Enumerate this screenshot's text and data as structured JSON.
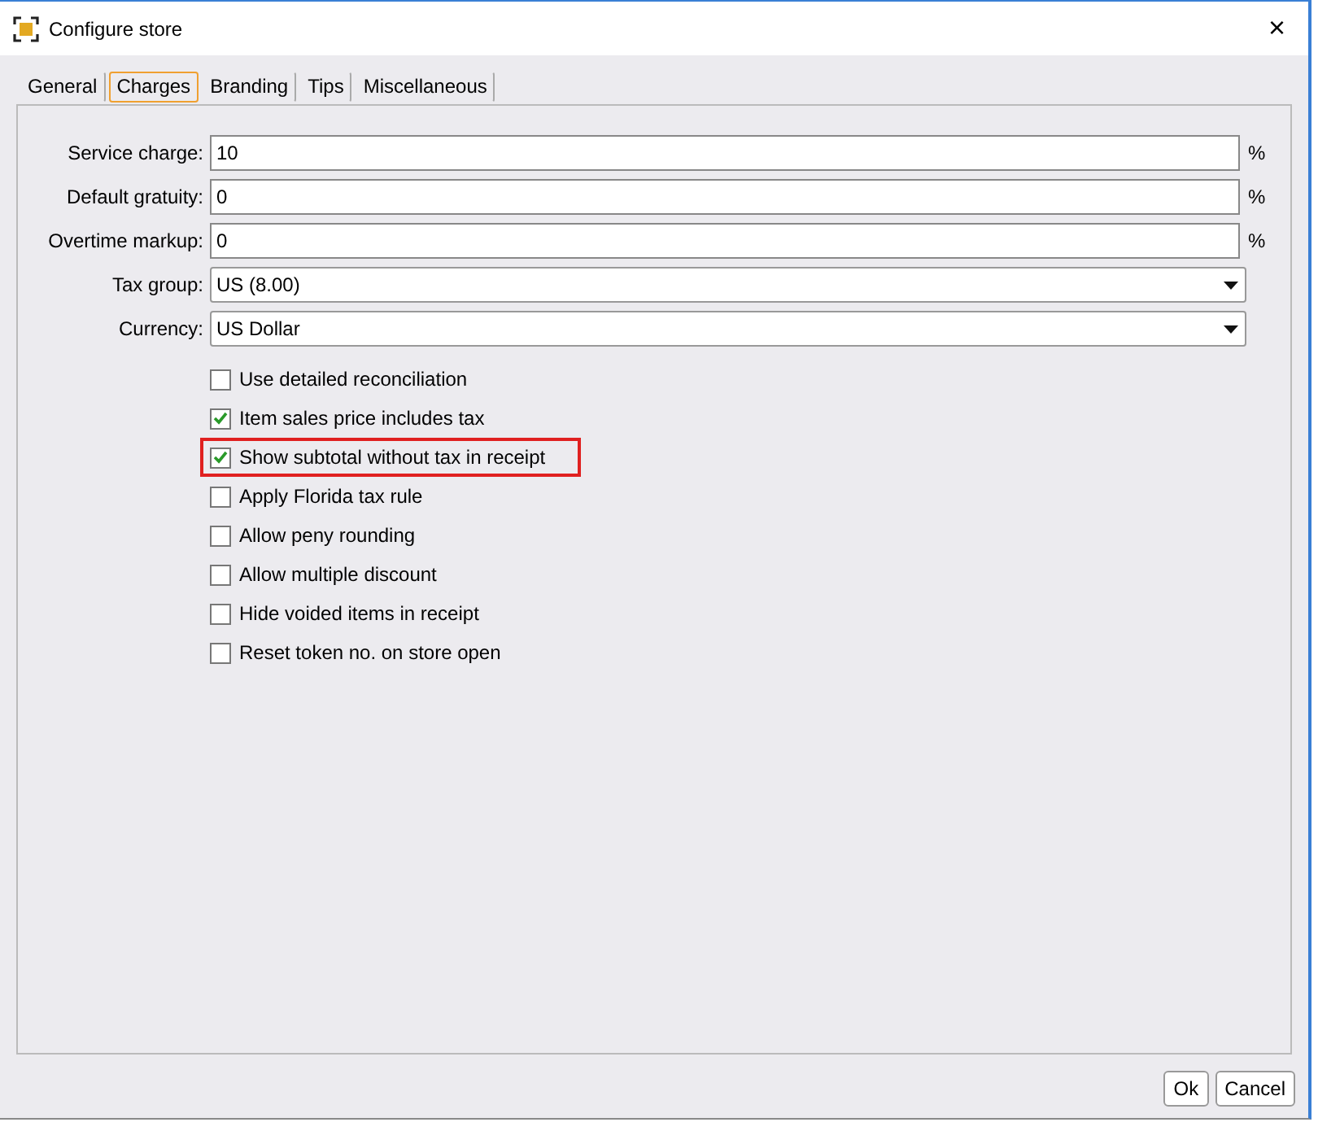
{
  "window": {
    "title": "Configure store",
    "close": "×"
  },
  "tabs": [
    {
      "label": "General",
      "selected": false
    },
    {
      "label": "Charges",
      "selected": true
    },
    {
      "label": "Branding",
      "selected": false
    },
    {
      "label": "Tips",
      "selected": false
    },
    {
      "label": "Miscellaneous",
      "selected": false
    }
  ],
  "fields": [
    {
      "kind": "text",
      "label": "Service charge:",
      "value": "10",
      "unit": "%"
    },
    {
      "kind": "text",
      "label": "Default gratuity:",
      "value": "0",
      "unit": "%"
    },
    {
      "kind": "text",
      "label": "Overtime markup:",
      "value": "0",
      "unit": "%"
    },
    {
      "kind": "select",
      "label": "Tax group:",
      "value": "US (8.00)"
    },
    {
      "kind": "select",
      "label": "Currency:",
      "value": "US Dollar"
    }
  ],
  "options": [
    {
      "label": "Use detailed reconciliation",
      "checked": false,
      "highlighted": false
    },
    {
      "label": "Item sales price includes tax",
      "checked": true,
      "highlighted": false
    },
    {
      "label": "Show subtotal without tax in receipt",
      "checked": true,
      "highlighted": true
    },
    {
      "label": "Apply Florida tax rule",
      "checked": false,
      "highlighted": false
    },
    {
      "label": "Allow peny rounding",
      "checked": false,
      "highlighted": false
    },
    {
      "label": "Allow multiple discount",
      "checked": false,
      "highlighted": false
    },
    {
      "label": "Hide voided items in receipt",
      "checked": false,
      "highlighted": false
    },
    {
      "label": "Reset token no. on store open",
      "checked": false,
      "highlighted": false
    }
  ],
  "buttons": [
    "Ok",
    "Cancel"
  ]
}
